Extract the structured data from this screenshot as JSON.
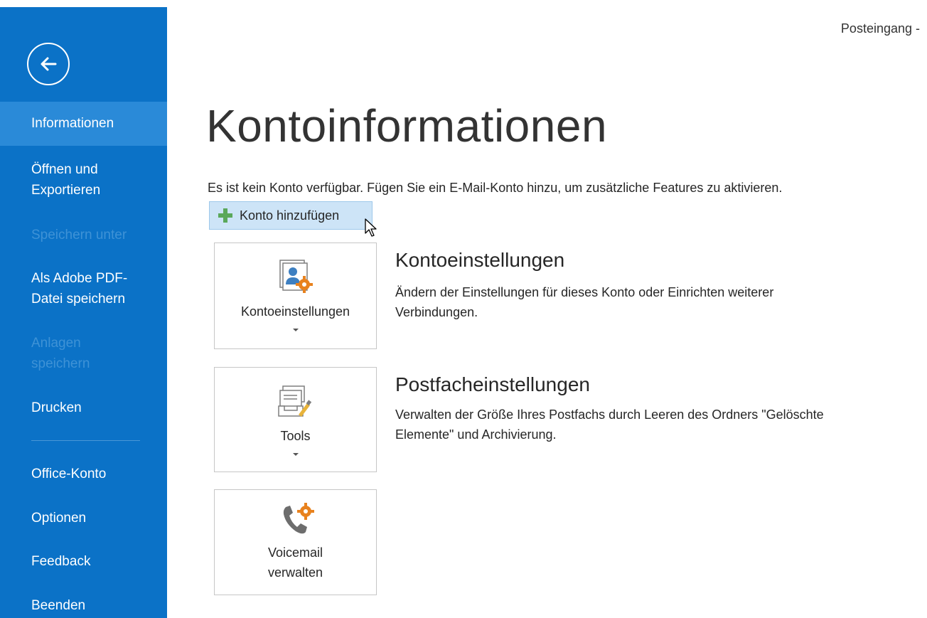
{
  "header": {
    "window_title": "Posteingang -"
  },
  "sidebar": {
    "back_label": "Zurück",
    "items": [
      {
        "label": "Informationen",
        "state": "active"
      },
      {
        "label": "Öffnen und Exportieren",
        "state": "normal"
      },
      {
        "label": "Speichern unter",
        "state": "disabled"
      },
      {
        "label": "Als Adobe PDF-Datei speichern",
        "state": "normal"
      },
      {
        "label": "Anlagen speichern",
        "state": "disabled"
      },
      {
        "label": "Drucken",
        "state": "normal"
      },
      {
        "label": "Office-Konto",
        "state": "normal"
      },
      {
        "label": "Optionen",
        "state": "normal"
      },
      {
        "label": "Feedback",
        "state": "normal"
      },
      {
        "label": "Beenden",
        "state": "normal"
      }
    ]
  },
  "main": {
    "title": "Kontoinformationen",
    "info_text": "Es ist kein Konto verfügbar. Fügen Sie ein E-Mail-Konto hinzu, um zusätzliche Features zu aktivieren.",
    "add_account_label": "Konto hinzufügen",
    "sections": [
      {
        "tile_label": "Kontoeinstellungen",
        "title": "Kontoeinstellungen",
        "description_line1": "Ändern der Einstellungen für dieses Konto oder Einrichten weiterer",
        "description_line2": "Verbindungen.",
        "icon": "account-settings-icon"
      },
      {
        "tile_label": "Tools",
        "title": "Postfacheinstellungen",
        "description_line1": "Verwalten der Größe Ihres Postfachs durch Leeren des Ordners \"Gelöschte",
        "description_line2": "Elemente\" und Archivierung.",
        "icon": "mailbox-tools-icon"
      },
      {
        "tile_label_line1": "Voicemail",
        "tile_label_line2": "verwalten",
        "icon": "voicemail-settings-icon"
      }
    ]
  },
  "colors": {
    "sidebar_bg": "#0b72c7",
    "sidebar_active": "#2a8ad8",
    "sidebar_disabled_text": "#3e92d6",
    "add_button_bg": "#cde4f7",
    "accent_orange": "#e8821e",
    "plus_green": "#5aa85a"
  }
}
